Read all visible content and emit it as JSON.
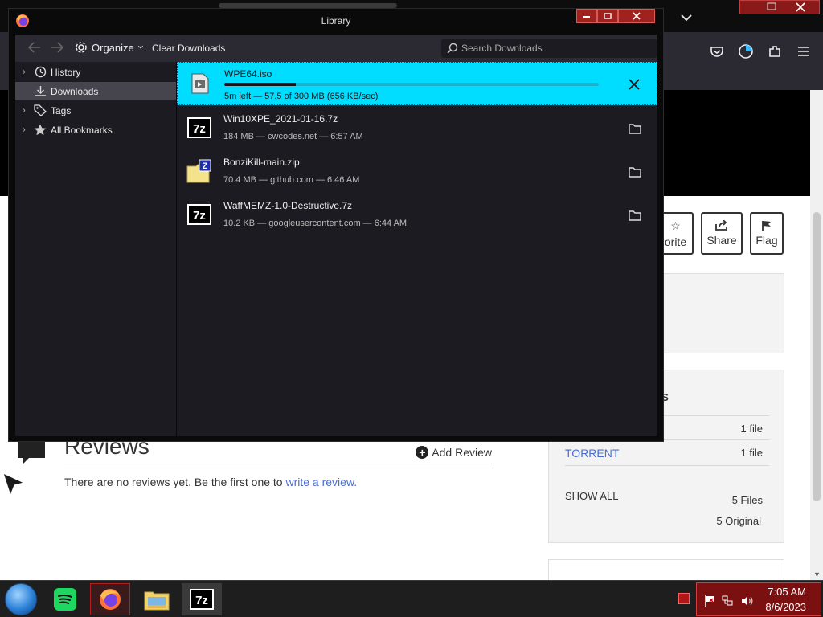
{
  "window": {
    "title": "Library"
  },
  "toolbar": {
    "organize_label": "Organize",
    "clear_label": "Clear Downloads",
    "search_placeholder": "Search Downloads"
  },
  "sidebar": {
    "items": [
      {
        "label": "History",
        "icon": "clock-icon",
        "selected": false
      },
      {
        "label": "Downloads",
        "icon": "download-icon",
        "selected": true
      },
      {
        "label": "Tags",
        "icon": "tag-icon",
        "selected": false
      },
      {
        "label": "All Bookmarks",
        "icon": "star-icon",
        "selected": false
      }
    ]
  },
  "downloads": [
    {
      "name": "WPE64.iso",
      "meta": "5m left — 57.5 of 300 MB (656 KB/sec)",
      "progress": 0.192,
      "status": "in-progress",
      "action": "cancel-icon"
    },
    {
      "name": "Win10XPE_2021-01-16.7z",
      "meta": "184 MB — cwcodes.net — 6:57 AM",
      "status": "done",
      "action": "folder-icon"
    },
    {
      "name": "BonziKill-main.zip",
      "meta": "70.4 MB — github.com — 6:46 AM",
      "status": "done",
      "action": "folder-icon"
    },
    {
      "name": "WaffMEMZ-1.0-Destructive.7z",
      "meta": "10.2 KB — googleusercontent.com — 6:44 AM",
      "status": "done",
      "action": "folder-icon"
    }
  ],
  "page": {
    "buttons": {
      "favorite": "orite",
      "share": "Share",
      "flag": "Flag"
    },
    "side_heading": "ONS",
    "rows": [
      {
        "label": "",
        "value": "1 file"
      },
      {
        "label": "TORRENT",
        "value": "1 file"
      },
      {
        "label": "SHOW ALL",
        "value": "5 Files"
      }
    ],
    "original_count": "5 Original",
    "reviews_title": "Reviews",
    "add_review": "Add Review",
    "no_reviews": "There are no reviews yet. Be the first one to",
    "write_review": "write a review."
  },
  "taskbar": {
    "time": "7:05 AM",
    "date": "8/6/2023"
  },
  "colors": {
    "accent": "#00ddff",
    "panel_bg": "#1c1b22",
    "toolbar_bg": "#2b2a33",
    "selected": "#46454d",
    "tray_red": "#7a1010"
  }
}
